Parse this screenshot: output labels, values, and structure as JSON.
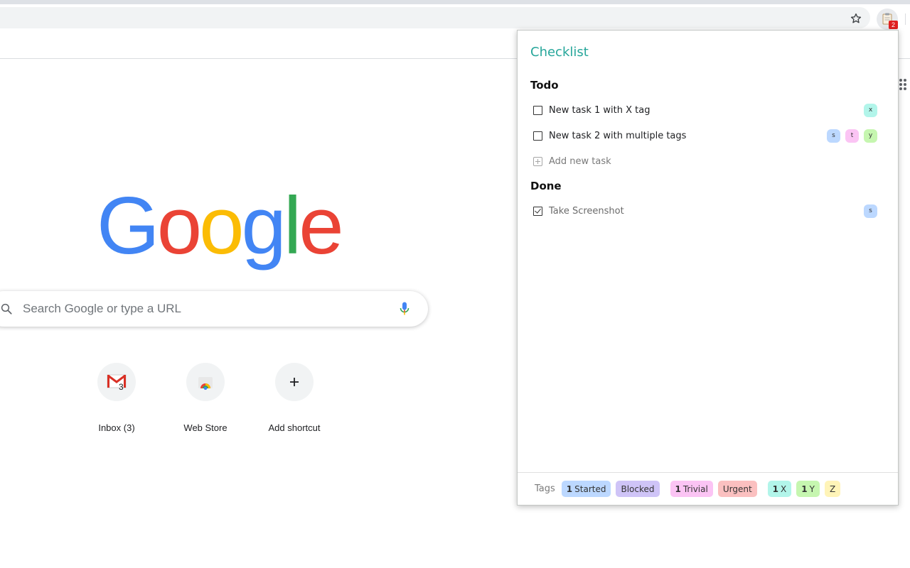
{
  "browser": {
    "extension_badge": "2"
  },
  "newtab": {
    "logo": [
      "G",
      "o",
      "o",
      "g",
      "l",
      "e"
    ],
    "logo_colors": [
      "#4285f4",
      "#ea4335",
      "#fbbc05",
      "#4285f4",
      "#34a853",
      "#ea4335"
    ],
    "search_placeholder": "Search Google or type a URL",
    "shortcuts": [
      {
        "label": "Inbox (3)",
        "icon": "gmail-icon",
        "badge": "3"
      },
      {
        "label": "Web Store",
        "icon": "web-store-icon"
      },
      {
        "label": "Add shortcut",
        "icon": "plus-icon"
      }
    ]
  },
  "popup": {
    "title": "Checklist",
    "todo_title": "Todo",
    "done_title": "Done",
    "todo": [
      {
        "text": "New task 1 with X tag",
        "tags": [
          {
            "label": "x",
            "color": "#b2f5ea"
          }
        ]
      },
      {
        "text": "New task 2 with multiple tags",
        "tags": [
          {
            "label": "s",
            "color": "#bcd8ff"
          },
          {
            "label": "t",
            "color": "#fbc4f4"
          },
          {
            "label": "y",
            "color": "#c6f6b0"
          }
        ]
      }
    ],
    "add_task": "Add new task",
    "done": [
      {
        "text": "Take Screenshot",
        "tags": [
          {
            "label": "s",
            "color": "#bcd8ff"
          }
        ]
      }
    ],
    "footer": {
      "label": "Tags",
      "chips": [
        {
          "count": "1",
          "label": "Started",
          "color": "#bcd8ff"
        },
        {
          "count": "",
          "label": "Blocked",
          "color": "#cfc4f7"
        },
        {
          "count": "1",
          "label": "Trivial",
          "color": "#fbc4f4"
        },
        {
          "count": "",
          "label": "Urgent",
          "color": "#fbc0c0"
        },
        {
          "count": "1",
          "label": "X",
          "color": "#b2f5ea"
        },
        {
          "count": "1",
          "label": "Y",
          "color": "#c6f6b0"
        },
        {
          "count": "",
          "label": "Z",
          "color": "#fff4b8"
        }
      ]
    }
  }
}
